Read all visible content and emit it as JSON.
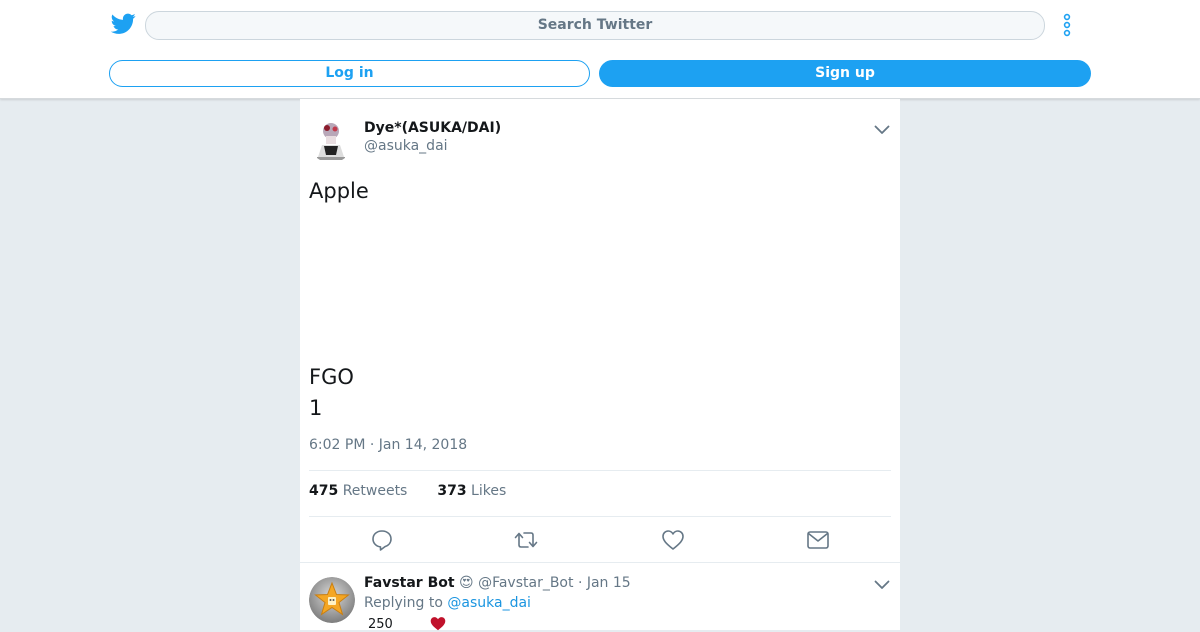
{
  "header": {
    "search_placeholder": "Search Twitter",
    "login_label": "Log in",
    "signup_label": "Sign up",
    "brand_color": "#1da1f2"
  },
  "tweet": {
    "display_name": "Dye*(ASUKA/DAI)",
    "handle": "@asuka_dai",
    "text_line1": "Apple",
    "text_line2": "FGO",
    "text_line3": "1",
    "timestamp": "6:02 PM · Jan 14, 2018",
    "retweets_count": "475",
    "retweets_label": "Retweets",
    "likes_count": "373",
    "likes_label": "Likes",
    "actions": [
      "reply-icon",
      "retweet-icon",
      "like-icon",
      "direct-message-icon"
    ]
  },
  "reply": {
    "display_name": "Favstar Bot",
    "emoji": "😍",
    "handle_date": "@Favstar_Bot · Jan 15",
    "replying_prefix": "Replying to",
    "replying_to": "@asuka_dai",
    "count_text": "250"
  }
}
